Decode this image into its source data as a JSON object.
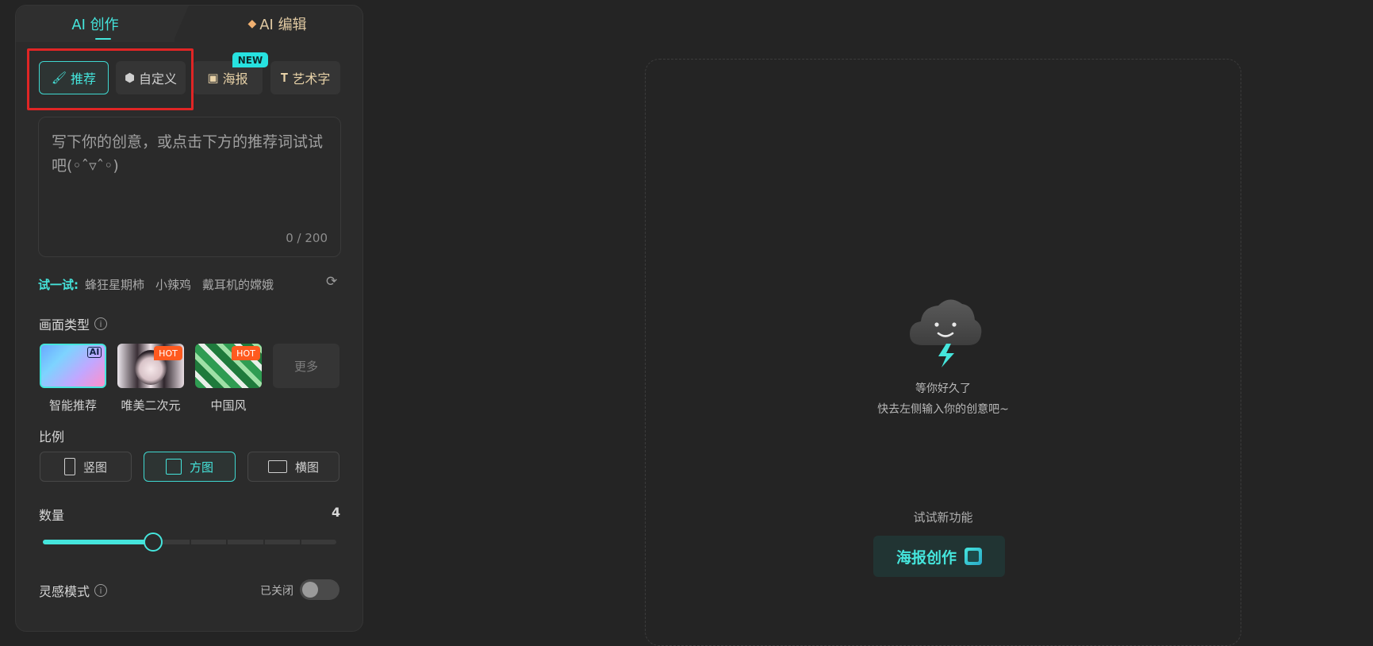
{
  "tabs": {
    "create_label": "AI 创作",
    "edit_label": "AI 编辑"
  },
  "modes": {
    "recommend": "推荐",
    "custom": "自定义",
    "poster": "海报",
    "art_text": "艺术字",
    "new_badge": "NEW"
  },
  "prompt": {
    "placeholder": "写下你的创意，或点击下方的推荐词试试吧(◦ˆ▿ˆ◦)",
    "char_count": "0 / 200"
  },
  "suggestions": {
    "label": "试一试:",
    "items": [
      "蜂狂星期柿",
      "小辣鸡",
      "戴耳机的嫦娥"
    ]
  },
  "style_section": {
    "label": "画面类型",
    "cards": [
      {
        "caption": "智能推荐",
        "badge": "AI"
      },
      {
        "caption": "唯美二次元",
        "badge": "HOT"
      },
      {
        "caption": "中国风",
        "badge": "HOT"
      }
    ],
    "more": "更多"
  },
  "ratio_section": {
    "label": "比例",
    "options": [
      "竖图",
      "方图",
      "横图"
    ],
    "selected": "方图"
  },
  "count_section": {
    "label": "数量",
    "value": "4",
    "slider_min": 1,
    "slider_max": 9,
    "slider_value": 4
  },
  "inspiration": {
    "label": "灵感模式",
    "status": "已关闭"
  },
  "canvas": {
    "empty_title": "等你好久了",
    "empty_sub": "快去左侧输入你的创意吧~",
    "try_new": "试试新功能",
    "cta_label": "海报创作"
  },
  "colors": {
    "accent": "#45e5dc",
    "highlight_box": "#e02525",
    "hot_badge": "#ff5a1f"
  }
}
